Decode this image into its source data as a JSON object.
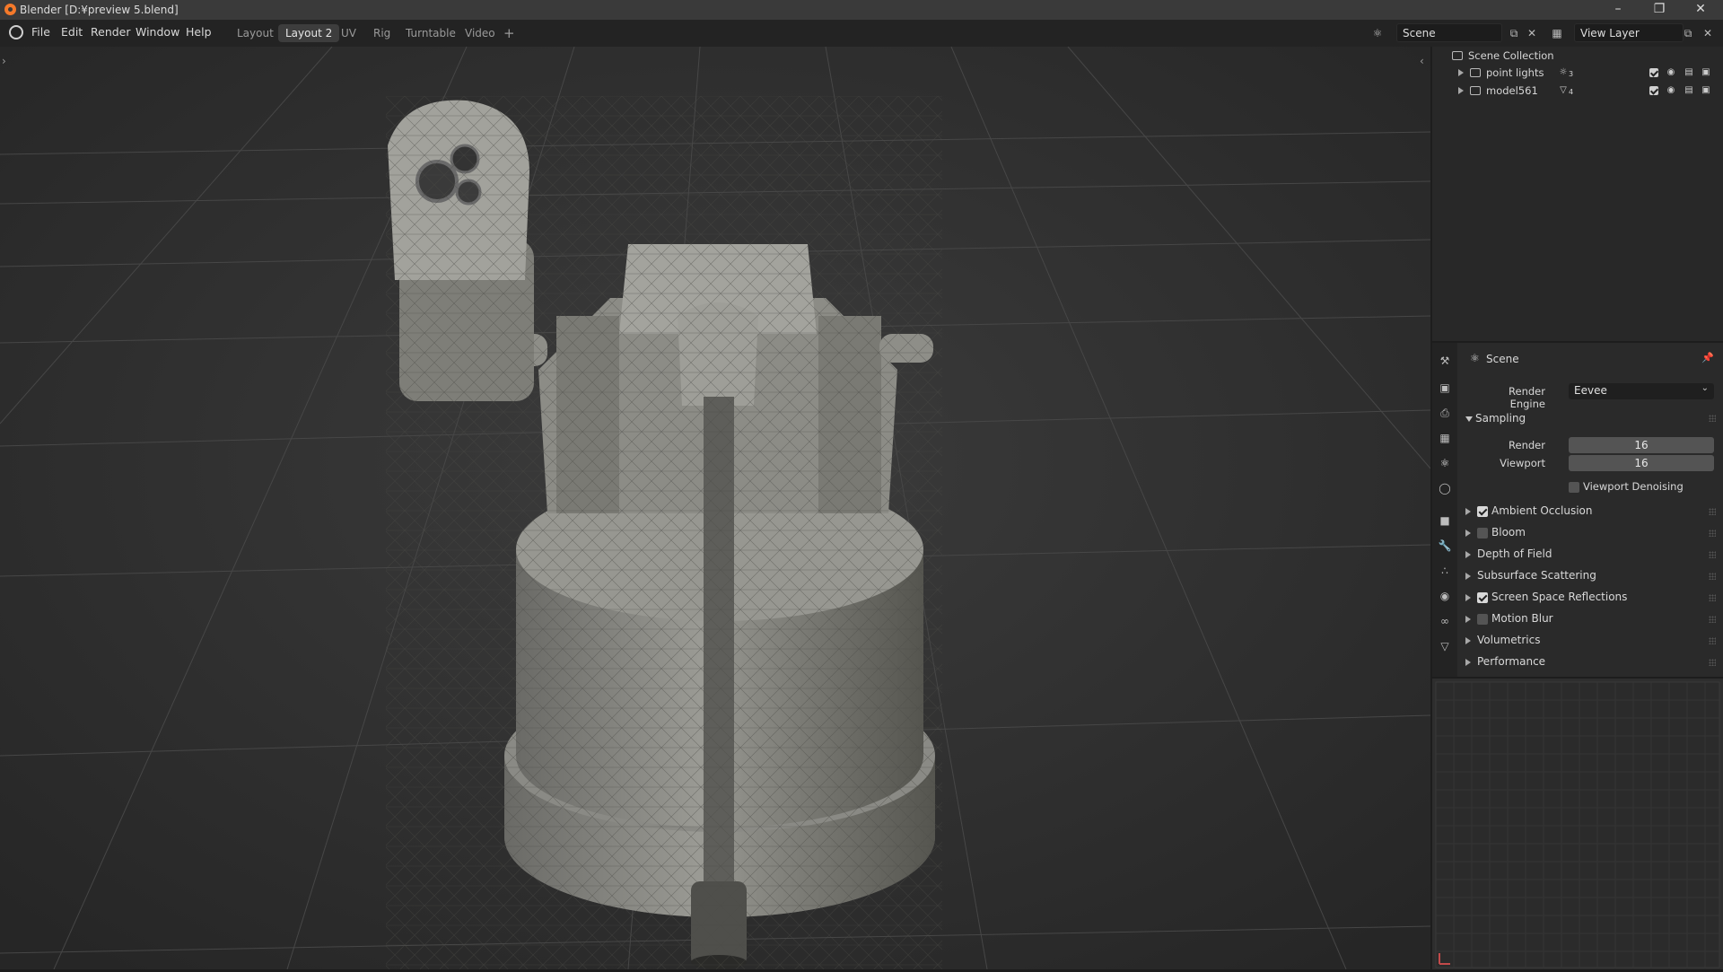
{
  "window": {
    "title": "Blender [D:¥preview 5.blend]"
  },
  "menu": [
    "File",
    "Edit",
    "Render",
    "Window",
    "Help"
  ],
  "workspaces": [
    {
      "label": "Layout",
      "active": false
    },
    {
      "label": "Layout 2",
      "active": true
    },
    {
      "label": "UV",
      "active": false
    },
    {
      "label": "Rig",
      "active": false
    },
    {
      "label": "Turntable",
      "active": false
    },
    {
      "label": "Video",
      "active": false
    }
  ],
  "add_workspace": "+",
  "scene_field": "Scene",
  "view_layer_field": "View Layer",
  "outliner": {
    "root": "Scene Collection",
    "items": [
      {
        "label": "point lights",
        "badge": "3"
      },
      {
        "label": "model561",
        "badge": "4"
      }
    ]
  },
  "properties": {
    "context_title": "Scene",
    "render_engine_label": "Render Engine",
    "render_engine_value": "Eevee",
    "sampling": {
      "header": "Sampling",
      "render_label": "Render",
      "render_value": "16",
      "viewport_label": "Viewport",
      "viewport_value": "16",
      "denoise_label": "Viewport Denoising"
    },
    "panels": [
      {
        "label": "Ambient Occlusion",
        "checkbox": true,
        "checked": true
      },
      {
        "label": "Bloom",
        "checkbox": true,
        "checked": false
      },
      {
        "label": "Depth of Field",
        "checkbox": false
      },
      {
        "label": "Subsurface Scattering",
        "checkbox": false
      },
      {
        "label": "Screen Space Reflections",
        "checkbox": true,
        "checked": true
      },
      {
        "label": "Motion Blur",
        "checkbox": true,
        "checked": false
      },
      {
        "label": "Volumetrics",
        "checkbox": false
      },
      {
        "label": "Performance",
        "checkbox": false
      }
    ]
  },
  "colors": {
    "accent": "#f5792a",
    "active_tab": "#3d3d3d",
    "viewport_bg": "#393939"
  },
  "icons": [
    "blender-logo",
    "minimize-icon",
    "restore-icon",
    "close-icon",
    "scene-icon",
    "view-layer-icon",
    "collection-icon",
    "eye-icon",
    "monitor-icon",
    "camera-icon",
    "pin-icon",
    "tool-icon",
    "render-icon",
    "output-icon",
    "view-layer-tab-icon",
    "scene-tab-icon",
    "world-icon",
    "object-icon",
    "modifier-icon",
    "particles-icon",
    "physics-icon",
    "constraints-icon",
    "data-icon"
  ]
}
